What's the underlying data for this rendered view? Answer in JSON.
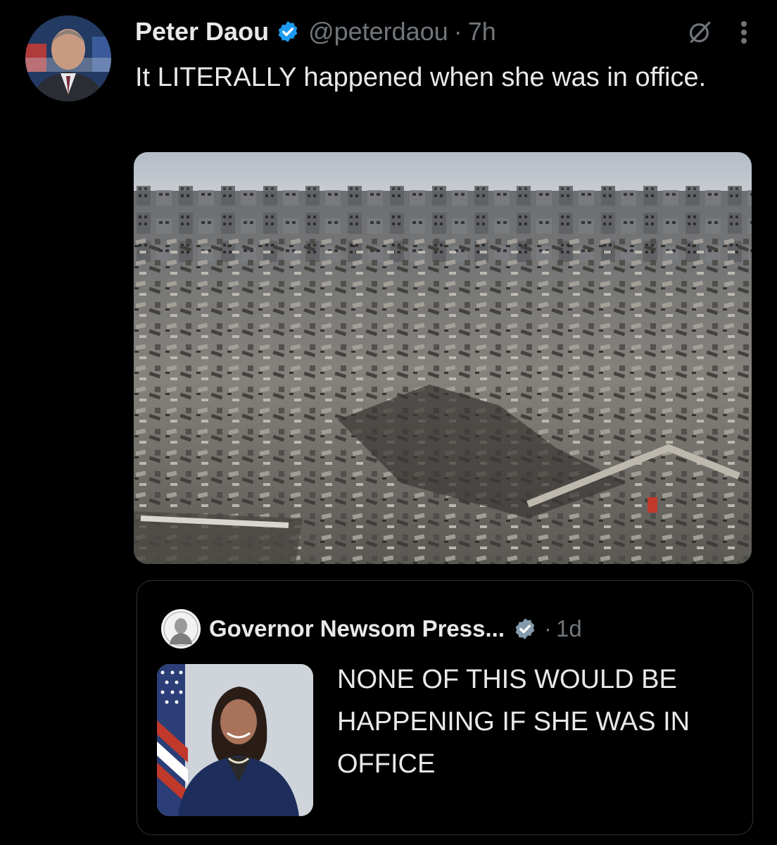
{
  "tweet": {
    "author_name": "Peter Daou",
    "handle": "@peterdaou",
    "separator": "·",
    "time": "7h",
    "text": "It LITERALLY happened when she was in office.",
    "verified_icon": "verified-badge-icon",
    "grok_icon": "grok-icon",
    "more_icon": "more-vertical-icon"
  },
  "quoted_tweet": {
    "author_name": "Governor Newsom Press...",
    "separator": "·",
    "time": "1d",
    "text": "NONE OF THIS WOULD BE HAPPENING IF SHE WAS IN OFFICE",
    "verified_icon": "verified-badge-icon"
  },
  "colors": {
    "background": "#000000",
    "text_primary": "#e7e9ea",
    "text_secondary": "#71767b",
    "verified_blue": "#1d9bf0",
    "verified_gray": "#829aab",
    "border": "#2f3336"
  }
}
